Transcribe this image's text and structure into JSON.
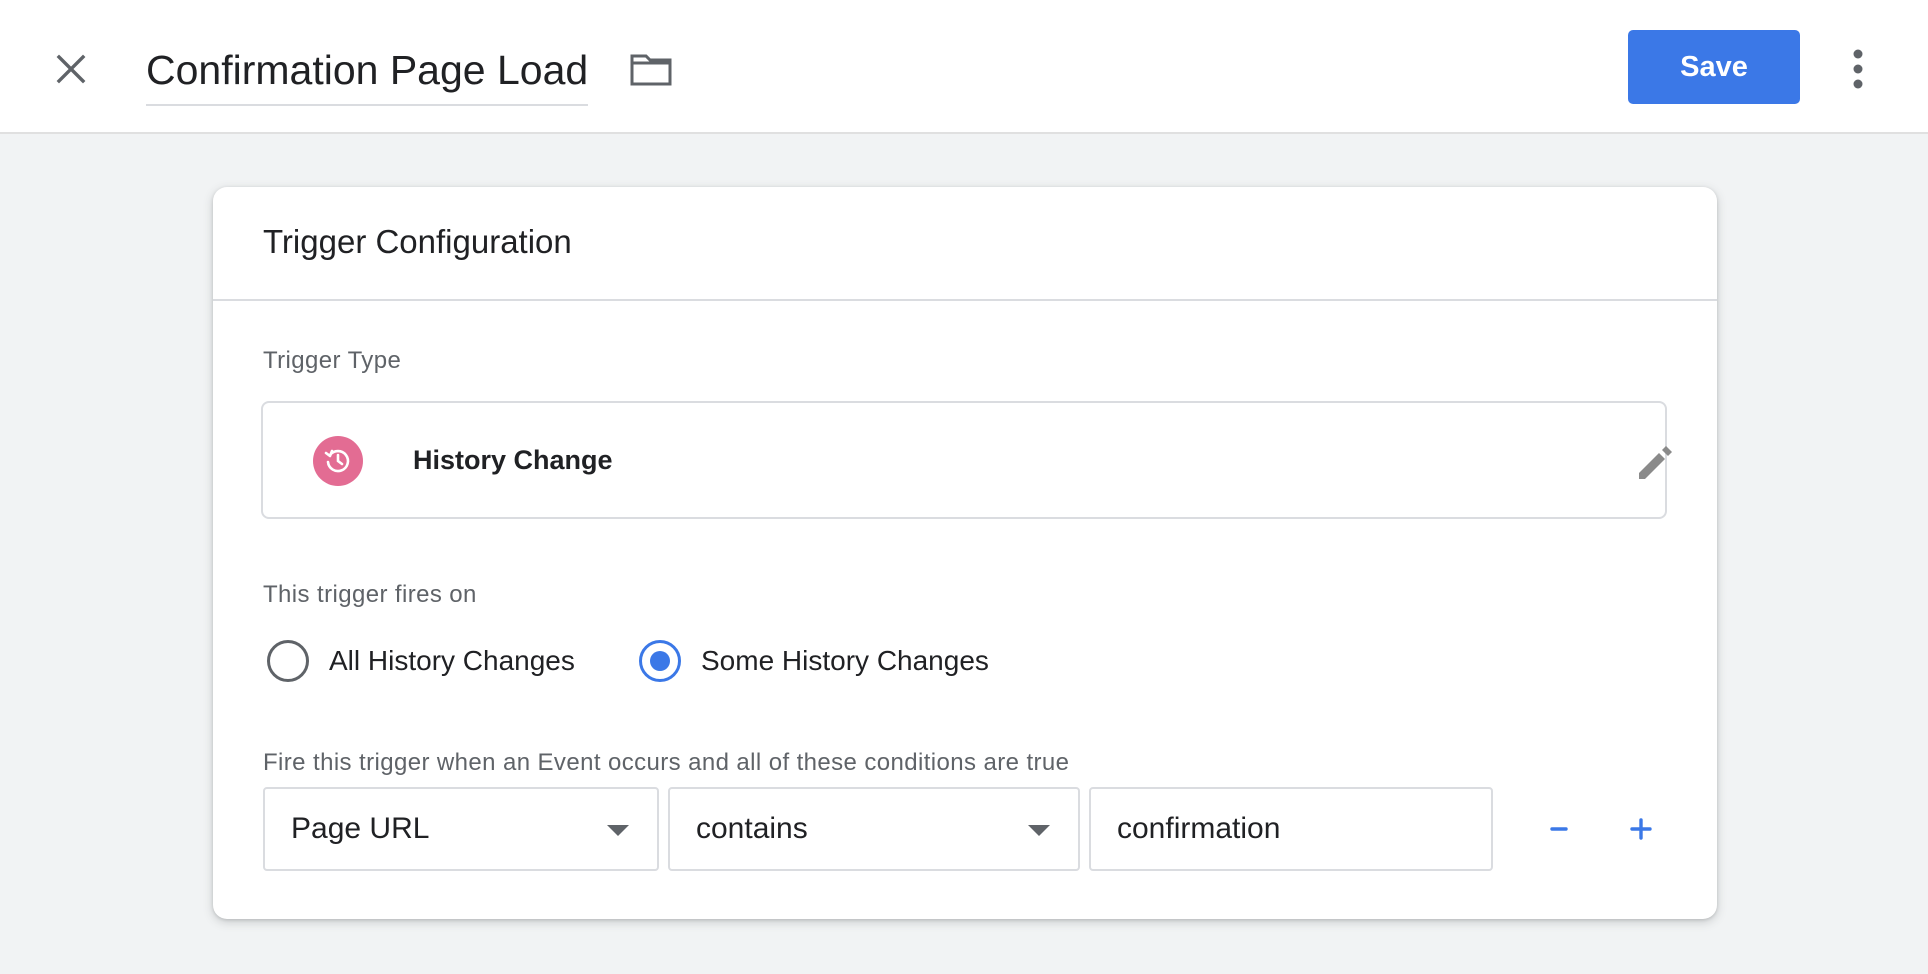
{
  "header": {
    "title": "Confirmation Page Load",
    "save_label": "Save",
    "close_icon": "close-icon",
    "folder_icon": "folder-icon",
    "more_icon": "more-vert-icon",
    "save_color": "#3b78e7"
  },
  "card": {
    "title": "Trigger Configuration",
    "trigger_type": {
      "label": "Trigger Type",
      "name": "History Change",
      "icon": "history-icon",
      "icon_color": "#e36c93",
      "edit_icon": "pencil-icon"
    },
    "fires_on": {
      "label": "This trigger fires on",
      "options": [
        {
          "label": "All History Changes",
          "selected": false
        },
        {
          "label": "Some History Changes",
          "selected": true
        }
      ]
    },
    "conditions": {
      "label": "Fire this trigger when an Event occurs and all of these conditions are true",
      "rows": [
        {
          "variable": "Page URL",
          "operator": "contains",
          "value": "confirmation"
        }
      ],
      "remove_label": "−",
      "add_label": "+"
    }
  }
}
